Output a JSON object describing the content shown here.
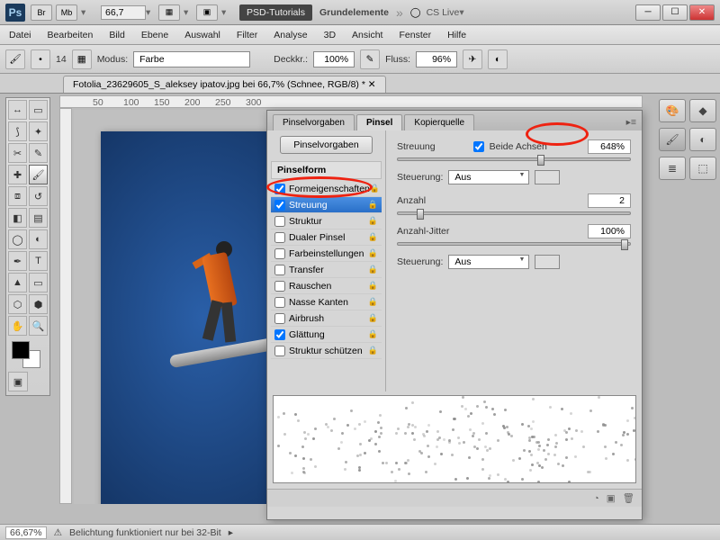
{
  "titlebar": {
    "zoom": "66,7",
    "tabs": [
      "PSD-Tutorials",
      "Grundelemente"
    ],
    "cslive": "CS Live"
  },
  "menu": [
    "Datei",
    "Bearbeiten",
    "Bild",
    "Ebene",
    "Auswahl",
    "Filter",
    "Analyse",
    "3D",
    "Ansicht",
    "Fenster",
    "Hilfe"
  ],
  "opt": {
    "brushnum": "14",
    "mode_lbl": "Modus:",
    "mode": "Farbe",
    "deck_lbl": "Deckkr.:",
    "deck": "100%",
    "fluss_lbl": "Fluss:",
    "fluss": "96%"
  },
  "doctab": "Fotolia_23629605_S_aleksey ipatov.jpg bei 66,7% (Schnee, RGB/8) *",
  "ruler": [
    "50",
    "100",
    "150",
    "200",
    "250",
    "300"
  ],
  "panel": {
    "tabs": [
      "Pinselvorgaben",
      "Pinsel",
      "Kopierquelle"
    ],
    "presetbtn": "Pinselvorgaben",
    "form_hdr": "Pinselform",
    "items": [
      {
        "label": "Formeigenschaften",
        "chk": true
      },
      {
        "label": "Streuung",
        "chk": true,
        "sel": true
      },
      {
        "label": "Struktur",
        "chk": false
      },
      {
        "label": "Dualer Pinsel",
        "chk": false
      },
      {
        "label": "Farbeinstellungen",
        "chk": false
      },
      {
        "label": "Transfer",
        "chk": false
      },
      {
        "label": "Rauschen",
        "chk": false
      },
      {
        "label": "Nasse Kanten",
        "chk": false
      },
      {
        "label": "Airbrush",
        "chk": false
      },
      {
        "label": "Glättung",
        "chk": true
      },
      {
        "label": "Struktur schützen",
        "chk": false
      }
    ],
    "streu_lbl": "Streuung",
    "beide": "Beide Achsen",
    "streu_val": "648%",
    "steuer_lbl": "Steuerung:",
    "steuer_val": "Aus",
    "anz_lbl": "Anzahl",
    "anz_val": "2",
    "jit_lbl": "Anzahl-Jitter",
    "jit_val": "100%"
  },
  "status": {
    "zoom": "66,67%",
    "msg": "Belichtung funktioniert nur bei 32-Bit"
  }
}
